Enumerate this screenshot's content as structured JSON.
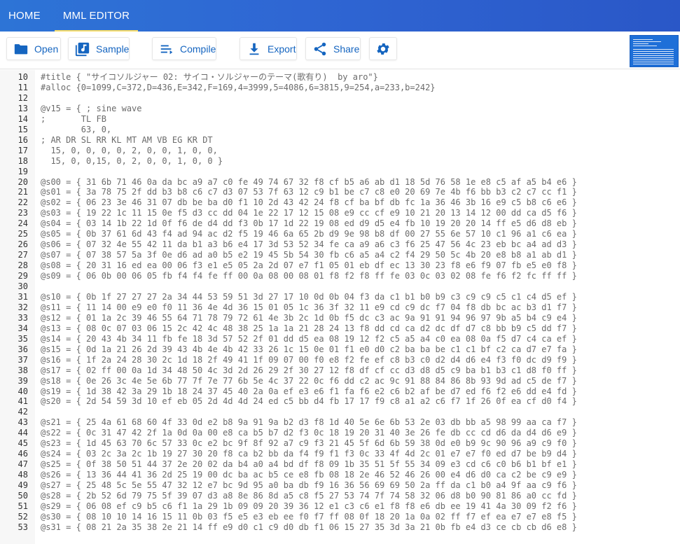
{
  "appbar": {
    "tabs": [
      {
        "label": "HOME",
        "active": false
      },
      {
        "label": "MML EDITOR",
        "active": true
      }
    ],
    "colors": {
      "background": "#2d6bd3",
      "active_indicator": "#f6dd6c"
    }
  },
  "toolbar": {
    "open_label": "Open",
    "sample_label": "Sample",
    "compile_label": "Compile",
    "export_label": "Export",
    "share_label": "Share",
    "settings_icon": "gear-icon"
  },
  "editor": {
    "lines": [
      {
        "n": "10",
        "kind": "title",
        "text": "#title { \"サイコソルジャー 02: サイコ・ソルジャーのテーマ(歌有り)  by aro\"}"
      },
      {
        "n": "11",
        "kind": "alloc",
        "text": "#alloc {0=1099,C=372,D=436,E=342,F=169,4=3999,5=4086,6=3815,9=254,a=233,b=242}"
      },
      {
        "n": "12",
        "kind": "blank",
        "text": ""
      },
      {
        "n": "13",
        "kind": "voice",
        "text": "@v15 = { ; sine wave"
      },
      {
        "n": "14",
        "kind": "comment",
        "text": ";       TL FB"
      },
      {
        "n": "15",
        "kind": "num",
        "text": "        63, 0,"
      },
      {
        "n": "16",
        "kind": "comment",
        "text": "; AR DR SL RR KL MT AM VB EG KR DT"
      },
      {
        "n": "17",
        "kind": "num",
        "text": "  15, 0, 0, 0, 0, 2, 0, 0, 1, 0, 0,"
      },
      {
        "n": "18",
        "kind": "num",
        "text": "  15, 0, 0,15, 0, 2, 0, 0, 1, 0, 0 }"
      },
      {
        "n": "19",
        "kind": "blank",
        "text": ""
      },
      {
        "n": "20",
        "kind": "hex",
        "text": "@s00 = { 31 6b 71 46 0a da bc a9 a7 c0 fe 49 74 67 32 f8 cf b5 a6 ab d1 18 5d 76 58 1e e8 c5 af a5 b4 e6 }"
      },
      {
        "n": "21",
        "kind": "hex",
        "text": "@s01 = { 3a 78 75 2f dd b3 b8 c6 c7 d3 07 53 7f 63 12 c9 b1 be c7 c8 e0 20 69 7e 4b f6 bb b3 c2 c7 cc f1 }"
      },
      {
        "n": "22",
        "kind": "hex",
        "text": "@s02 = { 06 23 3e 46 31 07 db be ba d0 f1 10 2d 43 42 24 f8 cf ba bf db fc 1a 36 46 3b 16 e9 c5 b8 c6 e6 }"
      },
      {
        "n": "23",
        "kind": "hex",
        "text": "@s03 = { 19 22 1c 11 15 0e f5 d3 cc dd 04 1e 22 17 12 15 08 e9 cc cf e9 10 21 20 13 14 12 00 dd ca d5 f6 }"
      },
      {
        "n": "24",
        "kind": "hex",
        "text": "@s04 = { 03 14 1b 22 1d 0f f6 de d4 dd f3 0b 17 1d 22 19 08 ed d9 d5 e4 fb 10 19 20 20 14 ff e5 d6 d8 eb }"
      },
      {
        "n": "25",
        "kind": "hex",
        "text": "@s05 = { 0b 37 61 6d 43 f4 ad 94 ac d2 f5 19 46 6a 65 2b d9 9e 98 b8 df 00 27 55 6e 57 10 c1 96 a1 c6 ea }"
      },
      {
        "n": "26",
        "kind": "hex",
        "text": "@s06 = { 07 32 4e 55 42 11 da b1 a3 b6 e4 17 3d 53 52 34 fe ca a9 a6 c3 f6 25 47 56 4c 23 eb bc a4 ad d3 }"
      },
      {
        "n": "27",
        "kind": "hex",
        "text": "@s07 = { 07 38 57 5a 3f 0e d6 ad a0 b5 e2 19 45 5b 54 30 fb c6 a5 a4 c2 f4 29 50 5c 4b 20 e8 b8 a1 ab d1 }"
      },
      {
        "n": "28",
        "kind": "hex",
        "text": "@s08 = { 20 31 16 ed ea 00 06 f3 e1 e5 05 2a 2d 07 e7 f1 05 01 eb df ec 13 30 23 f8 e6 f9 07 fb e5 e0 f8 }"
      },
      {
        "n": "29",
        "kind": "hex",
        "text": "@s09 = { 06 0b 00 06 05 fb f4 f4 fe ff 00 0a 08 00 08 01 f8 f2 f8 ff fe 03 0c 03 02 08 fe f6 f2 fc ff ff }"
      },
      {
        "n": "30",
        "kind": "blank",
        "text": ""
      },
      {
        "n": "31",
        "kind": "hex",
        "text": "@s10 = { 0b 1f 27 27 27 2a 34 44 53 59 51 3d 27 17 10 0d 0b 04 f3 da c1 b1 b0 b9 c3 c9 c9 c5 c1 c4 d5 ef }"
      },
      {
        "n": "32",
        "kind": "hex",
        "text": "@s11 = { 11 14 00 e9 e0 f0 11 36 4e 4d 36 15 01 05 1c 36 3f 32 11 e9 cd c9 dc f7 04 f8 db bc ac b3 d1 f7 }"
      },
      {
        "n": "33",
        "kind": "hex",
        "text": "@s12 = { 01 1a 2c 39 46 55 64 71 78 79 72 61 4e 3b 2c 1d 0b f5 dc c3 ac 9a 91 91 94 96 97 9b a5 b4 c9 e4 }"
      },
      {
        "n": "34",
        "kind": "hex",
        "text": "@s13 = { 08 0c 07 03 06 15 2c 42 4c 48 38 25 1a 1a 21 28 24 13 f8 dd cd ca d2 dc df d7 c8 bb b9 c5 dd f7 }"
      },
      {
        "n": "35",
        "kind": "hex",
        "text": "@s14 = { 20 43 4b 34 11 fb fe 18 3d 57 52 2f 01 dd d5 ea 08 19 12 f2 c5 a5 a4 c0 ea 08 0a f5 d7 c4 ca ef }"
      },
      {
        "n": "36",
        "kind": "hex",
        "text": "@s15 = { 0d 1a 21 26 2d 39 43 4b 4e 4b 42 33 26 1c 15 0e 01 f1 e0 d0 c2 ba ba be c1 c1 bf c2 ca d7 e7 fa }"
      },
      {
        "n": "37",
        "kind": "hex",
        "text": "@s16 = { 1f 2a 24 28 30 2c 1d 18 2f 49 41 1f 09 07 00 f0 e8 f2 fe ef c8 b3 c0 d2 d4 d6 e4 f3 f0 dc d9 f9 }"
      },
      {
        "n": "38",
        "kind": "hex",
        "text": "@s17 = { 02 ff 00 0a 1d 34 48 50 4c 3d 2d 26 29 2f 30 27 12 f8 df cf cc d3 d8 d5 c9 ba b1 b3 c1 d8 f0 ff }"
      },
      {
        "n": "39",
        "kind": "hex",
        "text": "@s18 = { 0e 26 3c 4e 5e 6b 77 7f 7e 77 6b 5e 4c 37 22 0c f6 dd c2 ac 9c 91 88 84 86 8b 93 9d ad c5 de f7 }"
      },
      {
        "n": "40",
        "kind": "hex",
        "text": "@s19 = { 1d 38 42 3a 29 1b 18 24 37 45 40 2a 0a ef e3 e6 f1 fa f6 e2 c6 b2 af be d7 ed f6 f2 e6 dd e4 fd }"
      },
      {
        "n": "41",
        "kind": "hex",
        "text": "@s20 = { 2d 54 59 3d 10 ef eb 05 2d 4d 4d 24 ed c5 bb d4 fb 17 17 f9 c8 a1 a2 c6 f7 1f 26 0f ea cf d0 f4 }"
      },
      {
        "n": "42",
        "kind": "blank",
        "text": ""
      },
      {
        "n": "43",
        "kind": "hex",
        "text": "@s21 = { 25 4a 61 68 60 4f 33 0d e2 b8 9a 91 9a b2 d3 f8 1d 40 5e 6e 6b 53 2e 03 db bb a5 98 99 aa ca f7 }"
      },
      {
        "n": "44",
        "kind": "hex",
        "text": "@s22 = { 0c 31 47 42 2f 1a 0d 0a 00 e8 ca b5 b7 d2 f3 0c 18 19 20 31 40 3e 26 fe db cc cd d6 da d4 d6 e9 }"
      },
      {
        "n": "45",
        "kind": "hex",
        "text": "@s23 = { 1d 45 63 70 6c 57 33 0c e2 bc 9f 8f 92 a7 c9 f3 21 45 5f 6d 6b 59 38 0d e0 b9 9c 90 96 a9 c9 f0 }"
      },
      {
        "n": "46",
        "kind": "hex",
        "text": "@s24 = { 03 2c 3a 2c 1b 19 27 30 20 f8 ca b2 bb da f4 f9 f1 f3 0c 33 4f 4d 2c 01 e7 e7 f0 ed d7 be b9 d4 }"
      },
      {
        "n": "47",
        "kind": "hex",
        "text": "@s25 = { 0f 38 50 51 44 37 2e 20 02 da b4 a0 a4 bd df f8 09 1b 35 51 5f 55 34 09 e3 cd c6 c0 b6 b1 bf e1 }"
      },
      {
        "n": "48",
        "kind": "hex",
        "text": "@s26 = { 13 36 44 41 36 2d 25 19 00 dc ba ac b5 ce e8 fb 08 18 2e 46 52 46 26 00 e4 d6 d0 ca c2 be c9 e9 }"
      },
      {
        "n": "49",
        "kind": "hex",
        "text": "@s27 = { 25 48 5c 5e 55 47 32 12 e7 bc 9d 95 a0 ba db f9 16 36 56 69 69 50 2a ff da c1 b0 a4 9f aa c9 f6 }"
      },
      {
        "n": "50",
        "kind": "hex",
        "text": "@s28 = { 2b 52 6d 79 75 5f 39 07 d3 a8 8e 86 8d a5 c8 f5 27 53 74 7f 74 58 32 06 d8 b0 90 81 86 a0 cc fd }"
      },
      {
        "n": "51",
        "kind": "hex",
        "text": "@s29 = { 06 08 ef c9 b5 c6 f1 1a 29 1b 09 09 20 39 36 12 e1 c3 c6 e1 f8 f8 e6 db ee 19 41 4a 30 09 f2 f6 }"
      },
      {
        "n": "52",
        "kind": "hex",
        "text": "@s30 = { 08 10 10 14 16 15 11 0b 03 f5 e5 e3 eb ee f0 f7 ff 08 0f 18 20 1a 0a 02 ff f7 ef ea e7 e7 e8 f5 }"
      },
      {
        "n": "53",
        "kind": "hex",
        "text": "@s31 = { 08 21 2a 35 38 2e 21 14 ff e9 d0 c1 c9 d0 db f1 06 15 27 35 3d 3a 21 0b fb e4 d3 ce cb cb d6 e8 }"
      }
    ]
  }
}
